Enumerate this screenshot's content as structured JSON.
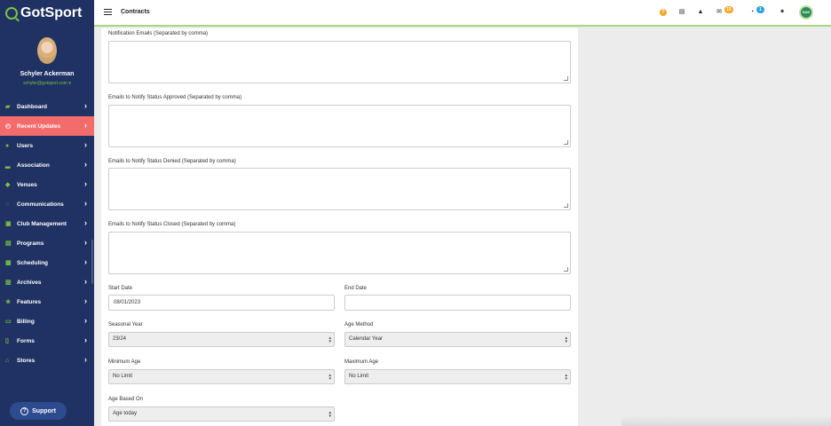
{
  "brand": {
    "logo_text": "GotSport"
  },
  "profile": {
    "name": "Schyler Ackerman",
    "email": "schyler@gotsport.com ▾"
  },
  "sidebar": {
    "items": [
      {
        "label": "Dashboard",
        "icon": "dashboard-icon"
      },
      {
        "label": "Recent Updates",
        "icon": "recent-updates-icon",
        "active": true
      },
      {
        "label": "Users",
        "icon": "users-icon"
      },
      {
        "label": "Association",
        "icon": "association-icon"
      },
      {
        "label": "Venues",
        "icon": "venues-icon"
      },
      {
        "label": "Communications",
        "icon": "communications-icon"
      },
      {
        "label": "Club Management",
        "icon": "club-management-icon"
      },
      {
        "label": "Programs",
        "icon": "programs-icon"
      },
      {
        "label": "Scheduling",
        "icon": "scheduling-icon"
      },
      {
        "label": "Archives",
        "icon": "archives-icon"
      },
      {
        "label": "Features",
        "icon": "features-icon"
      },
      {
        "label": "Billing",
        "icon": "billing-icon"
      },
      {
        "label": "Forms",
        "icon": "forms-icon"
      },
      {
        "label": "Stores",
        "icon": "stores-icon"
      }
    ],
    "support_label": "Support"
  },
  "header": {
    "title": "Contracts",
    "mail_badge": "15",
    "chat_badge": "1",
    "user_initials": "SAK"
  },
  "form": {
    "notification_emails_label": "Notification Emails (Separated by comma)",
    "approved_label": "Emails to Notify Status Approved (Separated by comma)",
    "denied_label": "Emails to Notify Status Denied (Separated by comma)",
    "closed_label": "Emails to Notify Status Closed (Separated by comma)",
    "start_date_label": "Start Date",
    "start_date_value": "08/01/2023",
    "end_date_label": "End Date",
    "end_date_value": "",
    "seasonal_year_label": "Seasonal Year",
    "seasonal_year_value": "23/24",
    "age_method_label": "Age Method",
    "age_method_value": "Calendar Year",
    "min_age_label": "Minimum Age",
    "min_age_value": "No Limit",
    "max_age_label": "Maximum Age",
    "max_age_value": "No Limit",
    "age_based_on_label": "Age Based On",
    "age_based_on_value": "Age today"
  },
  "colors": {
    "sidebar": "#1f3263",
    "accent": "#7ac143",
    "active": "#f36b6b"
  }
}
